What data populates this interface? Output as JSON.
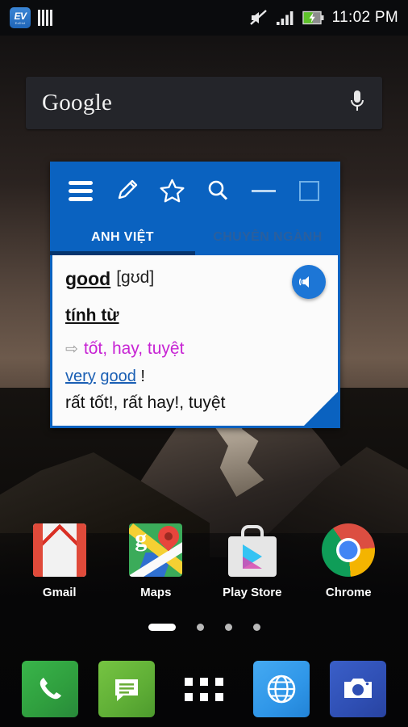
{
  "status_bar": {
    "app_icon_label": "EV",
    "app_icon_sub": "EzDict",
    "icons": [
      "ev-dictionary-icon",
      "barcode-icon",
      "silent-mode-icon",
      "signal-bars-icon",
      "battery-charging-icon"
    ],
    "time": "11:02 PM"
  },
  "google_widget": {
    "brand": "Google",
    "mic_icon": "microphone-icon"
  },
  "dictionary_widget": {
    "toolbar": {
      "menu": "menu-icon",
      "edit": "pencil-icon",
      "favorite": "star-icon",
      "search": "search-icon",
      "minimize": "minimize-icon",
      "maximize": "maximize-icon"
    },
    "tabs": [
      {
        "label": "ANH VIỆT",
        "active": true
      },
      {
        "label": "CHUYÊN NGÀNH",
        "active": false
      }
    ],
    "entry": {
      "headword": "good",
      "phonetic": "[gʊd]",
      "part_of_speech": "tính từ",
      "sense_bullet": "⇨",
      "sense": "tốt, hay, tuyệt",
      "example_en_1": "very",
      "example_en_2": "good",
      "example_en_punct": "!",
      "example_vi": "rất tốt!, rất hay!, tuyệt"
    },
    "speak_button": "speaker-icon",
    "colors": {
      "toolbar_blue": "#0a62c0",
      "tab_underline": "#05356e",
      "sense_magenta": "#c724d4",
      "link_blue": "#1a5fb4"
    }
  },
  "apps": [
    {
      "label": "Gmail",
      "icon": "gmail-icon"
    },
    {
      "label": "Maps",
      "icon": "maps-icon"
    },
    {
      "label": "Play Store",
      "icon": "play-store-icon"
    },
    {
      "label": "Chrome",
      "icon": "chrome-icon"
    }
  ],
  "page_indicator": {
    "total": 4,
    "active": 1
  },
  "dock": [
    {
      "name": "phone",
      "icon": "phone-icon"
    },
    {
      "name": "messages",
      "icon": "message-icon"
    },
    {
      "name": "app-drawer",
      "icon": "apps-grid-icon"
    },
    {
      "name": "browser",
      "icon": "globe-icon"
    },
    {
      "name": "camera",
      "icon": "camera-icon"
    }
  ]
}
